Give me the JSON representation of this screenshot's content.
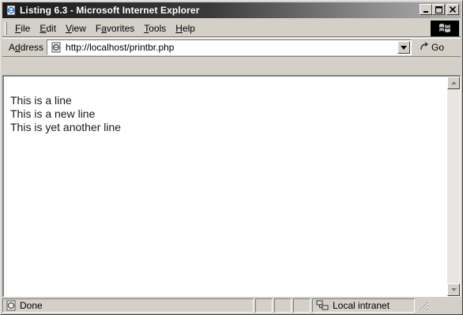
{
  "window": {
    "title": "Listing 6.3 - Microsoft Internet Explorer",
    "controls": {
      "minimize": "_",
      "maximize": "□",
      "close": "×"
    }
  },
  "menu": {
    "items": [
      {
        "label": "File",
        "accel": "F",
        "rest": "ile"
      },
      {
        "label": "Edit",
        "accel": "E",
        "rest": "dit"
      },
      {
        "label": "View",
        "accel": "V",
        "rest": "iew"
      },
      {
        "label": "Favorites",
        "pre": "F",
        "accel": "a",
        "rest": "vorites"
      },
      {
        "label": "Tools",
        "accel": "T",
        "rest": "ools"
      },
      {
        "label": "Help",
        "accel": "H",
        "rest": "elp"
      }
    ]
  },
  "address": {
    "label_pre": "A",
    "label_accel": "d",
    "label_rest": "dress",
    "url": "http://localhost/printbr.php",
    "go_label": "Go"
  },
  "page": {
    "lines": [
      "This is a line",
      "This is a new line",
      "This is yet another line"
    ]
  },
  "status": {
    "text": "Done",
    "zone": "Local intranet"
  },
  "icons": {
    "app": "ie-page-icon",
    "address": "ie-page-icon",
    "go": "go-arrow-icon",
    "throbber": "windows-logo-icon",
    "zone": "local-intranet-icon"
  }
}
